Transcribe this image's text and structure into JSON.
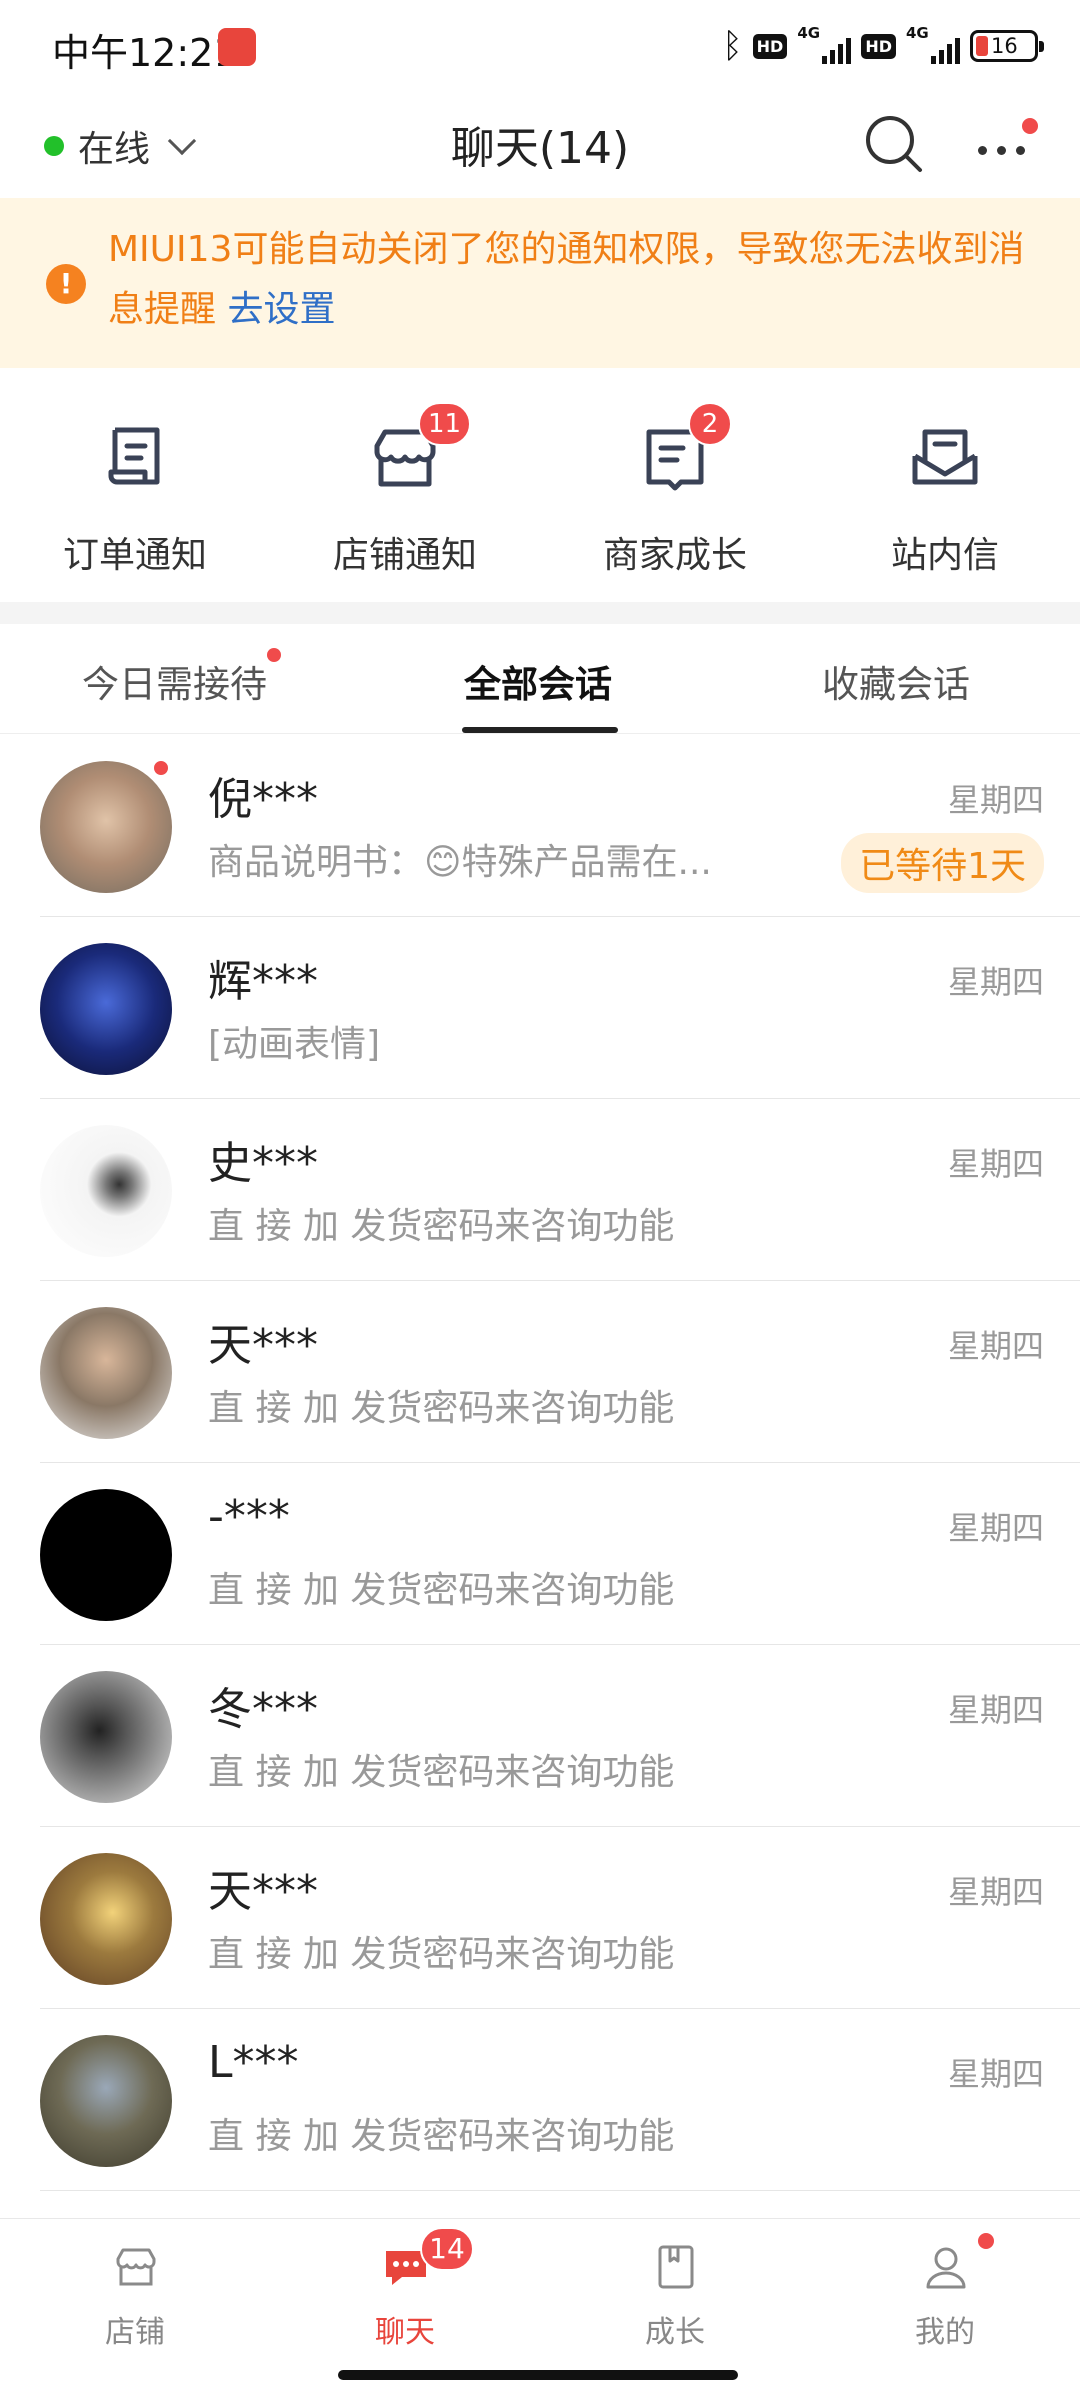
{
  "status_bar": {
    "time": "中午12:21",
    "net1": "4G",
    "net2": "4G",
    "hd1": "HD",
    "hd2": "HD",
    "battery": "16"
  },
  "header": {
    "status_label": "在线",
    "title": "聊天(14)"
  },
  "notice": {
    "text": "MIUI13可能自动关闭了您的通知权限，导致您无法收到消息提醒",
    "link": "去设置"
  },
  "quick_actions": [
    {
      "label": "订单通知",
      "badge": "",
      "icon": "order-receipt-icon"
    },
    {
      "label": "店铺通知",
      "badge": "11",
      "icon": "store-icon"
    },
    {
      "label": "商家成长",
      "badge": "2",
      "icon": "book-icon"
    },
    {
      "label": "站内信",
      "badge": "",
      "icon": "mail-icon"
    }
  ],
  "tabs": [
    {
      "label": "今日需接待",
      "dot": true
    },
    {
      "label": "全部会话",
      "active": true
    },
    {
      "label": "收藏会话"
    }
  ],
  "conversations": [
    {
      "name": "倪***",
      "message": "商品说明书：😊特殊产品需在...",
      "date": "星期四",
      "wait": "已等待1天",
      "unread_dot": true,
      "avatar_color": "#b08d74"
    },
    {
      "name": "辉***",
      "message": "[动画表情]",
      "date": "星期四",
      "avatar_color": "#1a2a7a"
    },
    {
      "name": "史***",
      "message": "直 接 加 发货密码来咨询功能",
      "date": "星期四",
      "avatar_color": "#e8e8e8"
    },
    {
      "name": "天***",
      "message": "直 接 加 发货密码来咨询功能",
      "date": "星期四",
      "avatar_color": "#8a7866"
    },
    {
      "name": "-***",
      "message": "直 接 加 发货密码来咨询功能",
      "date": "星期四",
      "avatar_color": "#000000"
    },
    {
      "name": "冬***",
      "message": "直 接 加 发货密码来咨询功能",
      "date": "星期四",
      "avatar_color": "#777777"
    },
    {
      "name": "天***",
      "message": "直 接 加 发货密码来咨询功能",
      "date": "星期四",
      "avatar_color": "#9c7a3e"
    },
    {
      "name": "L***",
      "message": "直 接 加 发货密码来咨询功能",
      "date": "星期四",
      "avatar_color": "#6e6a55"
    }
  ],
  "bottom_tabs": [
    {
      "label": "店铺",
      "icon": "store-icon"
    },
    {
      "label": "聊天",
      "icon": "chat-icon",
      "badge": "14",
      "active": true
    },
    {
      "label": "成长",
      "icon": "book-icon"
    },
    {
      "label": "我的",
      "icon": "person-icon",
      "dot": true
    }
  ],
  "colors": {
    "accent": "#e8453c",
    "badge": "#f04b4b",
    "notice_bg": "#fff6e3",
    "notice_text": "#f07f16",
    "link": "#2f6fc7",
    "online": "#22c02a"
  }
}
